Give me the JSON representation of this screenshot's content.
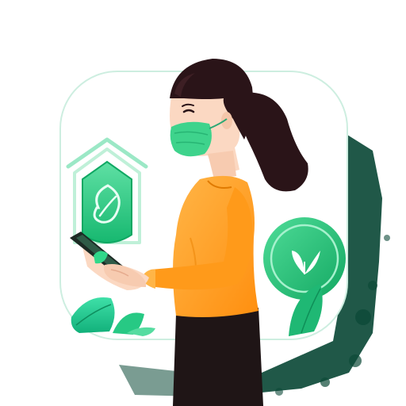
{
  "illustration": {
    "subject": "woman-wearing-face-mask-holding-smartphone",
    "icons": [
      "house-shield-icon",
      "leaf-icon",
      "leaf-badge-icon",
      "phone-leaf-icon"
    ]
  },
  "colors": {
    "background": "#ffffff",
    "card": "#ffffff",
    "card_border": "#c9ebdc",
    "card_shadow": "#0d4a38",
    "accent_green": "#2ecf88",
    "accent_green_dark": "#14a866",
    "mask_green": "#3ed38c",
    "shirt_orange": "#ff9a1a",
    "shirt_orange_light": "#ffb547",
    "hair": "#2a1418",
    "skin": "#fbd8c2",
    "pants": "#1f1516",
    "phone": "#1c2a24"
  }
}
